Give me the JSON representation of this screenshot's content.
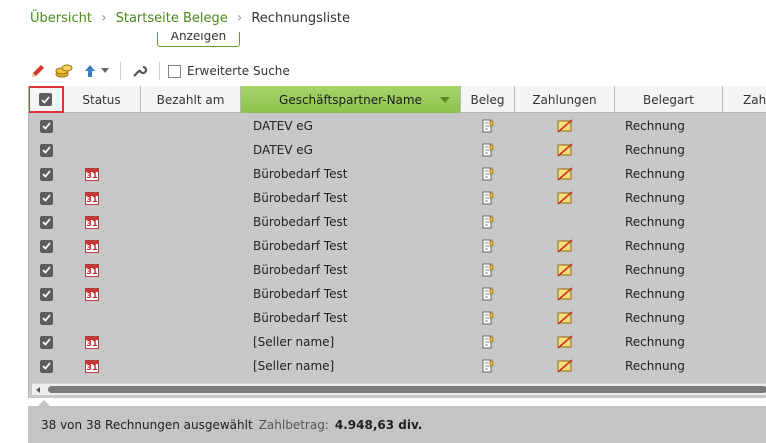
{
  "breadcrumb": {
    "items": [
      "Übersicht",
      "Startseite Belege"
    ],
    "current": "Rechnungsliste"
  },
  "anzeigen_label": "Anzeigen",
  "toolbar": {
    "icons": [
      "pencil-icon",
      "coins-icon",
      "arrow-up-icon",
      "chevron-down-icon",
      "wrench-icon"
    ],
    "extended_search_label": "Erweiterte Suche"
  },
  "grid": {
    "columns": [
      "",
      "Status",
      "Bezahlt am",
      "Geschäftspartner-Name",
      "Beleg",
      "Zahlungen",
      "Belegart",
      "Zah"
    ],
    "sorted_column": "Geschäftspartner-Name",
    "rows": [
      {
        "checked": true,
        "status_calendar": false,
        "status_text": "",
        "bezahlt_am": "",
        "partner": "DATEV eG",
        "beleg_icon": "document-icon",
        "zahlungen_icon": "payment-icon",
        "belegart": "Rechnung"
      },
      {
        "checked": true,
        "status_calendar": false,
        "status_text": "",
        "bezahlt_am": "",
        "partner": "DATEV eG",
        "beleg_icon": "document-icon",
        "zahlungen_icon": "payment-icon",
        "belegart": "Rechnung"
      },
      {
        "checked": true,
        "status_calendar": true,
        "status_text": "31",
        "bezahlt_am": "",
        "partner": "Bürobedarf Test",
        "beleg_icon": "document-icon",
        "zahlungen_icon": "payment-icon",
        "belegart": "Rechnung"
      },
      {
        "checked": true,
        "status_calendar": true,
        "status_text": "31",
        "bezahlt_am": "",
        "partner": "Bürobedarf Test",
        "beleg_icon": "document-icon",
        "zahlungen_icon": "payment-icon",
        "belegart": "Rechnung"
      },
      {
        "checked": true,
        "status_calendar": true,
        "status_text": "31",
        "bezahlt_am": "",
        "partner": "Bürobedarf Test",
        "beleg_icon": "document-icon",
        "zahlungen_icon": "",
        "belegart": "Rechnung"
      },
      {
        "checked": true,
        "status_calendar": true,
        "status_text": "31",
        "bezahlt_am": "",
        "partner": "Bürobedarf Test",
        "beleg_icon": "document-icon",
        "zahlungen_icon": "payment-icon",
        "belegart": "Rechnung"
      },
      {
        "checked": true,
        "status_calendar": true,
        "status_text": "31",
        "bezahlt_am": "",
        "partner": "Bürobedarf Test",
        "beleg_icon": "document-icon",
        "zahlungen_icon": "payment-icon",
        "belegart": "Rechnung"
      },
      {
        "checked": true,
        "status_calendar": true,
        "status_text": "31",
        "bezahlt_am": "",
        "partner": "Bürobedarf Test",
        "beleg_icon": "document-icon",
        "zahlungen_icon": "payment-icon",
        "belegart": "Rechnung"
      },
      {
        "checked": true,
        "status_calendar": false,
        "status_text": "",
        "bezahlt_am": "",
        "partner": "Bürobedarf Test",
        "beleg_icon": "document-icon",
        "zahlungen_icon": "payment-icon",
        "belegart": "Rechnung"
      },
      {
        "checked": true,
        "status_calendar": true,
        "status_text": "31",
        "bezahlt_am": "",
        "partner": "[Seller name]",
        "beleg_icon": "document-icon",
        "zahlungen_icon": "payment-icon",
        "belegart": "Rechnung"
      },
      {
        "checked": true,
        "status_calendar": true,
        "status_text": "31",
        "bezahlt_am": "",
        "partner": "[Seller name]",
        "beleg_icon": "document-icon",
        "zahlungen_icon": "payment-icon",
        "belegart": "Rechnung"
      }
    ]
  },
  "footer": {
    "selection_text": "38 von 38 Rechnungen ausgewählt",
    "amount_label": "Zahlbetrag:",
    "amount_value": "4.948,63 div."
  },
  "colors": {
    "accent_green": "#4a8a1c",
    "sorted_header": "#9ccb5c",
    "highlight_red": "#e0323a"
  }
}
